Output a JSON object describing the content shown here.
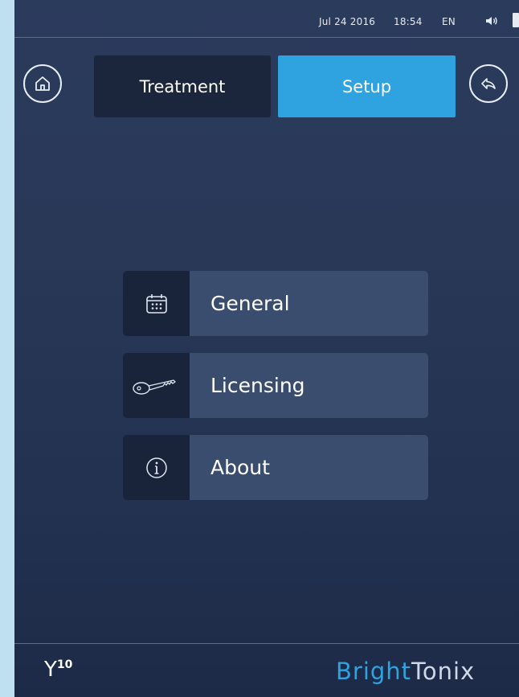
{
  "status_bar": {
    "date": "Jul 24 2016",
    "time": "18:54",
    "language": "EN",
    "volume_icon": "speaker-icon",
    "battery_icon": "battery-icon"
  },
  "nav": {
    "home_icon": "home-icon",
    "back_icon": "back-arrow-icon",
    "tabs": [
      {
        "label": "Treatment",
        "active": false
      },
      {
        "label": "Setup",
        "active": true
      }
    ]
  },
  "menu": {
    "items": [
      {
        "label": "General",
        "icon": "calendar-icon"
      },
      {
        "label": "Licensing",
        "icon": "key-icon"
      },
      {
        "label": "About",
        "icon": "info-icon"
      }
    ]
  },
  "footer": {
    "model_letter": "Y",
    "model_number": "10",
    "brand_part1": "Bright",
    "brand_part2": "Tonix"
  },
  "colors": {
    "accent": "#2ea3e0",
    "background": "#2a3858",
    "tab_inactive": "#1b263c",
    "menu_label_bg": "#3a4d6e",
    "menu_icon_bg": "#19243a"
  }
}
